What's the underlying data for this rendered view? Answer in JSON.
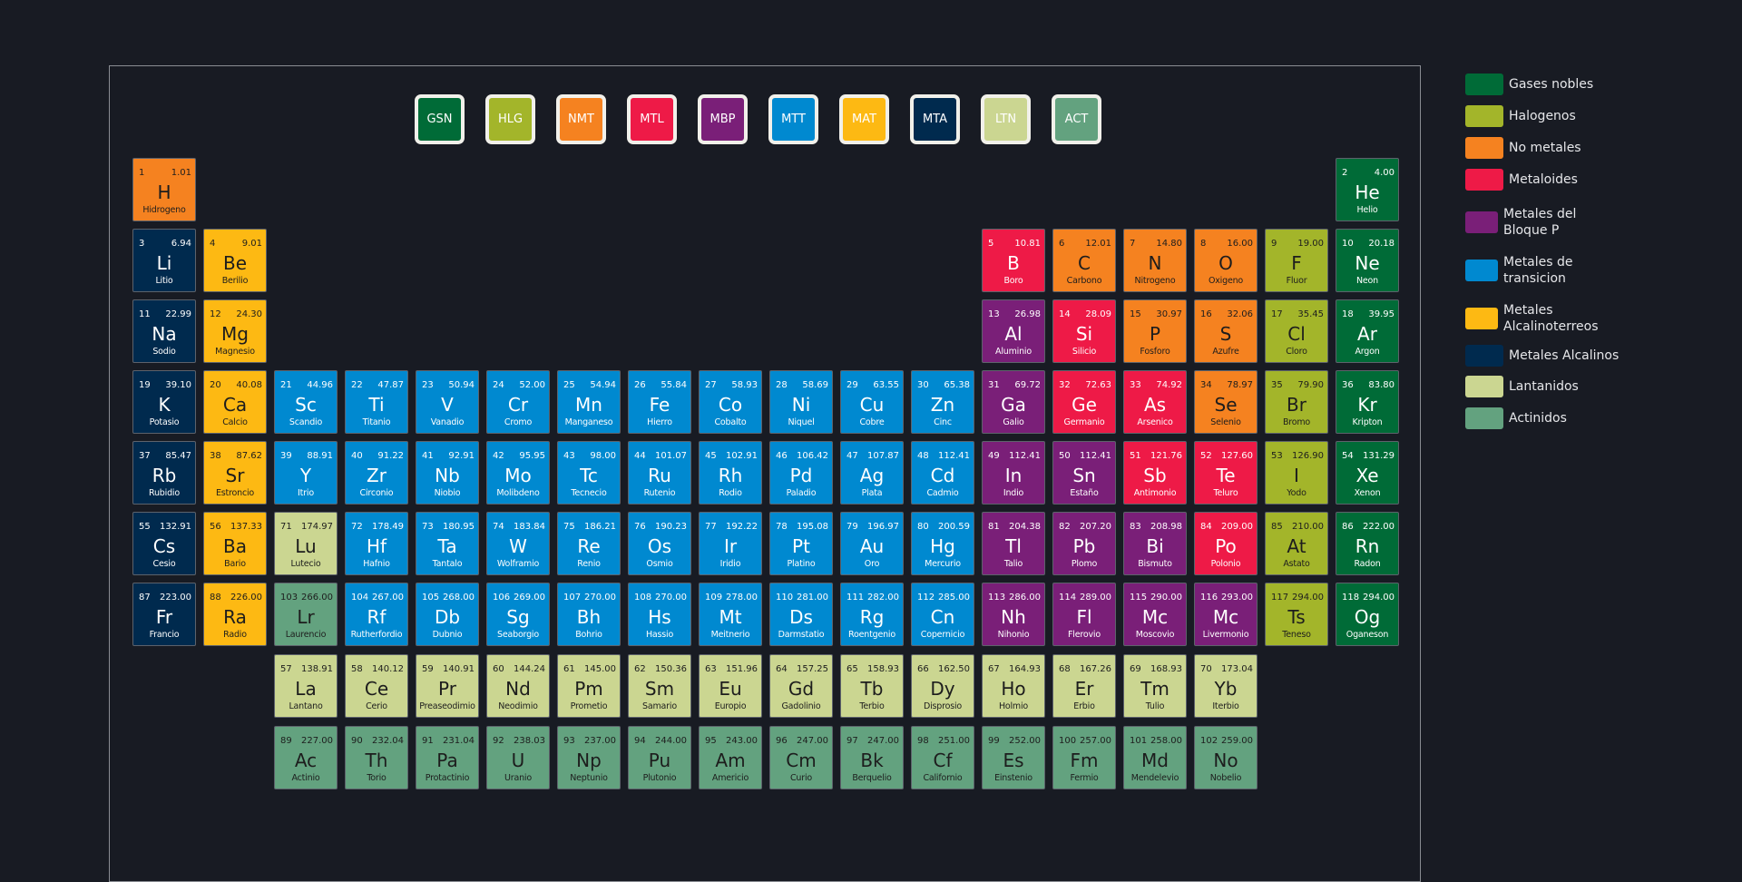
{
  "categories": [
    {
      "code": "GSN",
      "label": "Gases nobles",
      "color": "#006b37",
      "dark": false
    },
    {
      "code": "HLG",
      "label": "Halogenos",
      "color": "#a3b52a",
      "dark": true
    },
    {
      "code": "NMT",
      "label": "No metales",
      "color": "#f58220",
      "dark": true
    },
    {
      "code": "MTL",
      "label": "Metaloides",
      "color": "#ee1a47",
      "dark": false
    },
    {
      "code": "MBP",
      "label": "Metales del Bloque P",
      "color": "#7a1f78",
      "dark": false
    },
    {
      "code": "MTT",
      "label": "Metales de transicion",
      "color": "#0089d0",
      "dark": false
    },
    {
      "code": "MAT",
      "label": "Metales Alcalinoterreos",
      "color": "#fdb913",
      "dark": true
    },
    {
      "code": "MTA",
      "label": "Metales Alcalinos",
      "color": "#002a4e",
      "dark": false
    },
    {
      "code": "LTN",
      "label": "Lantanidos",
      "color": "#cbd691",
      "dark": true
    },
    {
      "code": "ACT",
      "label": "Actinidos",
      "color": "#63a27f",
      "dark": true
    }
  ],
  "elements": [
    {
      "n": "1",
      "m": "1.01",
      "s": "H",
      "name": "Hidrogeno",
      "c": "NMT",
      "period": 1,
      "group": 1
    },
    {
      "n": "2",
      "m": "4.00",
      "s": "He",
      "name": "Helio",
      "c": "GSN",
      "period": 1,
      "group": 18
    },
    {
      "n": "3",
      "m": "6.94",
      "s": "Li",
      "name": "Litio",
      "c": "MTA",
      "period": 2,
      "group": 1
    },
    {
      "n": "4",
      "m": "9.01",
      "s": "Be",
      "name": "Berilio",
      "c": "MAT",
      "period": 2,
      "group": 2
    },
    {
      "n": "5",
      "m": "10.81",
      "s": "B",
      "name": "Boro",
      "c": "MTL",
      "period": 2,
      "group": 13
    },
    {
      "n": "6",
      "m": "12.01",
      "s": "C",
      "name": "Carbono",
      "c": "NMT",
      "period": 2,
      "group": 14
    },
    {
      "n": "7",
      "m": "14.80",
      "s": "N",
      "name": "Nitrogeno",
      "c": "NMT",
      "period": 2,
      "group": 15
    },
    {
      "n": "8",
      "m": "16.00",
      "s": "O",
      "name": "Oxigeno",
      "c": "NMT",
      "period": 2,
      "group": 16
    },
    {
      "n": "9",
      "m": "19.00",
      "s": "F",
      "name": "Fluor",
      "c": "HLG",
      "period": 2,
      "group": 17
    },
    {
      "n": "10",
      "m": "20.18",
      "s": "Ne",
      "name": "Neon",
      "c": "GSN",
      "period": 2,
      "group": 18
    },
    {
      "n": "11",
      "m": "22.99",
      "s": "Na",
      "name": "Sodio",
      "c": "MTA",
      "period": 3,
      "group": 1
    },
    {
      "n": "12",
      "m": "24.30",
      "s": "Mg",
      "name": "Magnesio",
      "c": "MAT",
      "period": 3,
      "group": 2
    },
    {
      "n": "13",
      "m": "26.98",
      "s": "Al",
      "name": "Aluminio",
      "c": "MBP",
      "period": 3,
      "group": 13
    },
    {
      "n": "14",
      "m": "28.09",
      "s": "Si",
      "name": "Silicio",
      "c": "MTL",
      "period": 3,
      "group": 14
    },
    {
      "n": "15",
      "m": "30.97",
      "s": "P",
      "name": "Fosforo",
      "c": "NMT",
      "period": 3,
      "group": 15
    },
    {
      "n": "16",
      "m": "32.06",
      "s": "S",
      "name": "Azufre",
      "c": "NMT",
      "period": 3,
      "group": 16
    },
    {
      "n": "17",
      "m": "35.45",
      "s": "Cl",
      "name": "Cloro",
      "c": "HLG",
      "period": 3,
      "group": 17
    },
    {
      "n": "18",
      "m": "39.95",
      "s": "Ar",
      "name": "Argon",
      "c": "GSN",
      "period": 3,
      "group": 18
    },
    {
      "n": "19",
      "m": "39.10",
      "s": "K",
      "name": "Potasio",
      "c": "MTA",
      "period": 4,
      "group": 1
    },
    {
      "n": "20",
      "m": "40.08",
      "s": "Ca",
      "name": "Calcio",
      "c": "MAT",
      "period": 4,
      "group": 2
    },
    {
      "n": "21",
      "m": "44.96",
      "s": "Sc",
      "name": "Scandio",
      "c": "MTT",
      "period": 4,
      "group": 3
    },
    {
      "n": "22",
      "m": "47.87",
      "s": "Ti",
      "name": "Titanio",
      "c": "MTT",
      "period": 4,
      "group": 4
    },
    {
      "n": "23",
      "m": "50.94",
      "s": "V",
      "name": "Vanadio",
      "c": "MTT",
      "period": 4,
      "group": 5
    },
    {
      "n": "24",
      "m": "52.00",
      "s": "Cr",
      "name": "Cromo",
      "c": "MTT",
      "period": 4,
      "group": 6
    },
    {
      "n": "25",
      "m": "54.94",
      "s": "Mn",
      "name": "Manganeso",
      "c": "MTT",
      "period": 4,
      "group": 7
    },
    {
      "n": "26",
      "m": "55.84",
      "s": "Fe",
      "name": "Hierro",
      "c": "MTT",
      "period": 4,
      "group": 8
    },
    {
      "n": "27",
      "m": "58.93",
      "s": "Co",
      "name": "Cobalto",
      "c": "MTT",
      "period": 4,
      "group": 9
    },
    {
      "n": "28",
      "m": "58.69",
      "s": "Ni",
      "name": "Niquel",
      "c": "MTT",
      "period": 4,
      "group": 10
    },
    {
      "n": "29",
      "m": "63.55",
      "s": "Cu",
      "name": "Cobre",
      "c": "MTT",
      "period": 4,
      "group": 11
    },
    {
      "n": "30",
      "m": "65.38",
      "s": "Zn",
      "name": "Cinc",
      "c": "MTT",
      "period": 4,
      "group": 12
    },
    {
      "n": "31",
      "m": "69.72",
      "s": "Ga",
      "name": "Galio",
      "c": "MBP",
      "period": 4,
      "group": 13
    },
    {
      "n": "32",
      "m": "72.63",
      "s": "Ge",
      "name": "Germanio",
      "c": "MTL",
      "period": 4,
      "group": 14
    },
    {
      "n": "33",
      "m": "74.92",
      "s": "As",
      "name": "Arsenico",
      "c": "MTL",
      "period": 4,
      "group": 15
    },
    {
      "n": "34",
      "m": "78.97",
      "s": "Se",
      "name": "Selenio",
      "c": "NMT",
      "period": 4,
      "group": 16
    },
    {
      "n": "35",
      "m": "79.90",
      "s": "Br",
      "name": "Bromo",
      "c": "HLG",
      "period": 4,
      "group": 17
    },
    {
      "n": "36",
      "m": "83.80",
      "s": "Kr",
      "name": "Kripton",
      "c": "GSN",
      "period": 4,
      "group": 18
    },
    {
      "n": "37",
      "m": "85.47",
      "s": "Rb",
      "name": "Rubidio",
      "c": "MTA",
      "period": 5,
      "group": 1
    },
    {
      "n": "38",
      "m": "87.62",
      "s": "Sr",
      "name": "Estroncio",
      "c": "MAT",
      "period": 5,
      "group": 2
    },
    {
      "n": "39",
      "m": "88.91",
      "s": "Y",
      "name": "Itrio",
      "c": "MTT",
      "period": 5,
      "group": 3
    },
    {
      "n": "40",
      "m": "91.22",
      "s": "Zr",
      "name": "Circonio",
      "c": "MTT",
      "period": 5,
      "group": 4
    },
    {
      "n": "41",
      "m": "92.91",
      "s": "Nb",
      "name": "Niobio",
      "c": "MTT",
      "period": 5,
      "group": 5
    },
    {
      "n": "42",
      "m": "95.95",
      "s": "Mo",
      "name": "Molibdeno",
      "c": "MTT",
      "period": 5,
      "group": 6
    },
    {
      "n": "43",
      "m": "98.00",
      "s": "Tc",
      "name": "Tecnecio",
      "c": "MTT",
      "period": 5,
      "group": 7
    },
    {
      "n": "44",
      "m": "101.07",
      "s": "Ru",
      "name": "Rutenio",
      "c": "MTT",
      "period": 5,
      "group": 8
    },
    {
      "n": "45",
      "m": "102.91",
      "s": "Rh",
      "name": "Rodio",
      "c": "MTT",
      "period": 5,
      "group": 9
    },
    {
      "n": "46",
      "m": "106.42",
      "s": "Pd",
      "name": "Paladio",
      "c": "MTT",
      "period": 5,
      "group": 10
    },
    {
      "n": "47",
      "m": "107.87",
      "s": "Ag",
      "name": "Plata",
      "c": "MTT",
      "period": 5,
      "group": 11
    },
    {
      "n": "48",
      "m": "112.41",
      "s": "Cd",
      "name": "Cadmio",
      "c": "MTT",
      "period": 5,
      "group": 12
    },
    {
      "n": "49",
      "m": "112.41",
      "s": "In",
      "name": "Indio",
      "c": "MBP",
      "period": 5,
      "group": 13
    },
    {
      "n": "50",
      "m": "112.41",
      "s": "Sn",
      "name": "Estaño",
      "c": "MBP",
      "period": 5,
      "group": 14
    },
    {
      "n": "51",
      "m": "121.76",
      "s": "Sb",
      "name": "Antimonio",
      "c": "MTL",
      "period": 5,
      "group": 15
    },
    {
      "n": "52",
      "m": "127.60",
      "s": "Te",
      "name": "Teluro",
      "c": "MTL",
      "period": 5,
      "group": 16
    },
    {
      "n": "53",
      "m": "126.90",
      "s": "I",
      "name": "Yodo",
      "c": "HLG",
      "period": 5,
      "group": 17
    },
    {
      "n": "54",
      "m": "131.29",
      "s": "Xe",
      "name": "Xenon",
      "c": "GSN",
      "period": 5,
      "group": 18
    },
    {
      "n": "55",
      "m": "132.91",
      "s": "Cs",
      "name": "Cesio",
      "c": "MTA",
      "period": 6,
      "group": 1
    },
    {
      "n": "56",
      "m": "137.33",
      "s": "Ba",
      "name": "Bario",
      "c": "MAT",
      "period": 6,
      "group": 2
    },
    {
      "n": "71",
      "m": "174.97",
      "s": "Lu",
      "name": "Lutecio",
      "c": "LTN",
      "period": 6,
      "group": 3
    },
    {
      "n": "72",
      "m": "178.49",
      "s": "Hf",
      "name": "Hafnio",
      "c": "MTT",
      "period": 6,
      "group": 4
    },
    {
      "n": "73",
      "m": "180.95",
      "s": "Ta",
      "name": "Tantalo",
      "c": "MTT",
      "period": 6,
      "group": 5
    },
    {
      "n": "74",
      "m": "183.84",
      "s": "W",
      "name": "Wolframio",
      "c": "MTT",
      "period": 6,
      "group": 6
    },
    {
      "n": "75",
      "m": "186.21",
      "s": "Re",
      "name": "Renio",
      "c": "MTT",
      "period": 6,
      "group": 7
    },
    {
      "n": "76",
      "m": "190.23",
      "s": "Os",
      "name": "Osmio",
      "c": "MTT",
      "period": 6,
      "group": 8
    },
    {
      "n": "77",
      "m": "192.22",
      "s": "Ir",
      "name": "Iridio",
      "c": "MTT",
      "period": 6,
      "group": 9
    },
    {
      "n": "78",
      "m": "195.08",
      "s": "Pt",
      "name": "Platino",
      "c": "MTT",
      "period": 6,
      "group": 10
    },
    {
      "n": "79",
      "m": "196.97",
      "s": "Au",
      "name": "Oro",
      "c": "MTT",
      "period": 6,
      "group": 11
    },
    {
      "n": "80",
      "m": "200.59",
      "s": "Hg",
      "name": "Mercurio",
      "c": "MTT",
      "period": 6,
      "group": 12
    },
    {
      "n": "81",
      "m": "204.38",
      "s": "Tl",
      "name": "Talio",
      "c": "MBP",
      "period": 6,
      "group": 13
    },
    {
      "n": "82",
      "m": "207.20",
      "s": "Pb",
      "name": "Plomo",
      "c": "MBP",
      "period": 6,
      "group": 14
    },
    {
      "n": "83",
      "m": "208.98",
      "s": "Bi",
      "name": "Bismuto",
      "c": "MBP",
      "period": 6,
      "group": 15
    },
    {
      "n": "84",
      "m": "209.00",
      "s": "Po",
      "name": "Polonio",
      "c": "MTL",
      "period": 6,
      "group": 16
    },
    {
      "n": "85",
      "m": "210.00",
      "s": "At",
      "name": "Astato",
      "c": "HLG",
      "period": 6,
      "group": 17
    },
    {
      "n": "86",
      "m": "222.00",
      "s": "Rn",
      "name": "Radon",
      "c": "GSN",
      "period": 6,
      "group": 18
    },
    {
      "n": "87",
      "m": "223.00",
      "s": "Fr",
      "name": "Francio",
      "c": "MTA",
      "period": 7,
      "group": 1
    },
    {
      "n": "88",
      "m": "226.00",
      "s": "Ra",
      "name": "Radio",
      "c": "MAT",
      "period": 7,
      "group": 2
    },
    {
      "n": "103",
      "m": "266.00",
      "s": "Lr",
      "name": "Laurencio",
      "c": "ACT",
      "period": 7,
      "group": 3
    },
    {
      "n": "104",
      "m": "267.00",
      "s": "Rf",
      "name": "Rutherfordio",
      "c": "MTT",
      "period": 7,
      "group": 4
    },
    {
      "n": "105",
      "m": "268.00",
      "s": "Db",
      "name": "Dubnio",
      "c": "MTT",
      "period": 7,
      "group": 5
    },
    {
      "n": "106",
      "m": "269.00",
      "s": "Sg",
      "name": "Seaborgio",
      "c": "MTT",
      "period": 7,
      "group": 6
    },
    {
      "n": "107",
      "m": "270.00",
      "s": "Bh",
      "name": "Bohrio",
      "c": "MTT",
      "period": 7,
      "group": 7
    },
    {
      "n": "108",
      "m": "270.00",
      "s": "Hs",
      "name": "Hassio",
      "c": "MTT",
      "period": 7,
      "group": 8
    },
    {
      "n": "109",
      "m": "278.00",
      "s": "Mt",
      "name": "Meitnerio",
      "c": "MTT",
      "period": 7,
      "group": 9
    },
    {
      "n": "110",
      "m": "281.00",
      "s": "Ds",
      "name": "Darmstatio",
      "c": "MTT",
      "period": 7,
      "group": 10
    },
    {
      "n": "111",
      "m": "282.00",
      "s": "Rg",
      "name": "Roentgenio",
      "c": "MTT",
      "period": 7,
      "group": 11
    },
    {
      "n": "112",
      "m": "285.00",
      "s": "Cn",
      "name": "Copernicio",
      "c": "MTT",
      "period": 7,
      "group": 12
    },
    {
      "n": "113",
      "m": "286.00",
      "s": "Nh",
      "name": "Nihonio",
      "c": "MBP",
      "period": 7,
      "group": 13
    },
    {
      "n": "114",
      "m": "289.00",
      "s": "Fl",
      "name": "Flerovio",
      "c": "MBP",
      "period": 7,
      "group": 14
    },
    {
      "n": "115",
      "m": "290.00",
      "s": "Mc",
      "name": "Moscovio",
      "c": "MBP",
      "period": 7,
      "group": 15
    },
    {
      "n": "116",
      "m": "293.00",
      "s": "Mc",
      "name": "Livermonio",
      "c": "MBP",
      "period": 7,
      "group": 16
    },
    {
      "n": "117",
      "m": "294.00",
      "s": "Ts",
      "name": "Teneso",
      "c": "HLG",
      "period": 7,
      "group": 17
    },
    {
      "n": "118",
      "m": "294.00",
      "s": "Og",
      "name": "Oganeson",
      "c": "GSN",
      "period": 7,
      "group": 18
    },
    {
      "n": "57",
      "m": "138.91",
      "s": "La",
      "name": "Lantano",
      "c": "LTN",
      "period": 8,
      "group": 3
    },
    {
      "n": "58",
      "m": "140.12",
      "s": "Ce",
      "name": "Cerio",
      "c": "LTN",
      "period": 8,
      "group": 4
    },
    {
      "n": "59",
      "m": "140.91",
      "s": "Pr",
      "name": "Preaseodimio",
      "c": "LTN",
      "period": 8,
      "group": 5
    },
    {
      "n": "60",
      "m": "144.24",
      "s": "Nd",
      "name": "Neodimio",
      "c": "LTN",
      "period": 8,
      "group": 6
    },
    {
      "n": "61",
      "m": "145.00",
      "s": "Pm",
      "name": "Prometio",
      "c": "LTN",
      "period": 8,
      "group": 7
    },
    {
      "n": "62",
      "m": "150.36",
      "s": "Sm",
      "name": "Samario",
      "c": "LTN",
      "period": 8,
      "group": 8
    },
    {
      "n": "63",
      "m": "151.96",
      "s": "Eu",
      "name": "Europio",
      "c": "LTN",
      "period": 8,
      "group": 9
    },
    {
      "n": "64",
      "m": "157.25",
      "s": "Gd",
      "name": "Gadolinio",
      "c": "LTN",
      "period": 8,
      "group": 10
    },
    {
      "n": "65",
      "m": "158.93",
      "s": "Tb",
      "name": "Terbio",
      "c": "LTN",
      "period": 8,
      "group": 11
    },
    {
      "n": "66",
      "m": "162.50",
      "s": "Dy",
      "name": "Disprosio",
      "c": "LTN",
      "period": 8,
      "group": 12
    },
    {
      "n": "67",
      "m": "164.93",
      "s": "Ho",
      "name": "Holmio",
      "c": "LTN",
      "period": 8,
      "group": 13
    },
    {
      "n": "68",
      "m": "167.26",
      "s": "Er",
      "name": "Erbio",
      "c": "LTN",
      "period": 8,
      "group": 14
    },
    {
      "n": "69",
      "m": "168.93",
      "s": "Tm",
      "name": "Tulio",
      "c": "LTN",
      "period": 8,
      "group": 15
    },
    {
      "n": "70",
      "m": "173.04",
      "s": "Yb",
      "name": "Iterbio",
      "c": "LTN",
      "period": 8,
      "group": 16
    },
    {
      "n": "89",
      "m": "227.00",
      "s": "Ac",
      "name": "Actinio",
      "c": "ACT",
      "period": 9,
      "group": 3
    },
    {
      "n": "90",
      "m": "232.04",
      "s": "Th",
      "name": "Torio",
      "c": "ACT",
      "period": 9,
      "group": 4
    },
    {
      "n": "91",
      "m": "231.04",
      "s": "Pa",
      "name": "Protactinio",
      "c": "ACT",
      "period": 9,
      "group": 5
    },
    {
      "n": "92",
      "m": "238.03",
      "s": "U",
      "name": "Uranio",
      "c": "ACT",
      "period": 9,
      "group": 6
    },
    {
      "n": "93",
      "m": "237.00",
      "s": "Np",
      "name": "Neptunio",
      "c": "ACT",
      "period": 9,
      "group": 7
    },
    {
      "n": "94",
      "m": "244.00",
      "s": "Pu",
      "name": "Plutonio",
      "c": "ACT",
      "period": 9,
      "group": 8
    },
    {
      "n": "95",
      "m": "243.00",
      "s": "Am",
      "name": "Americio",
      "c": "ACT",
      "period": 9,
      "group": 9
    },
    {
      "n": "96",
      "m": "247.00",
      "s": "Cm",
      "name": "Curio",
      "c": "ACT",
      "period": 9,
      "group": 10
    },
    {
      "n": "97",
      "m": "247.00",
      "s": "Bk",
      "name": "Berquelio",
      "c": "ACT",
      "period": 9,
      "group": 11
    },
    {
      "n": "98",
      "m": "251.00",
      "s": "Cf",
      "name": "Californio",
      "c": "ACT",
      "period": 9,
      "group": 12
    },
    {
      "n": "99",
      "m": "252.00",
      "s": "Es",
      "name": "Einstenio",
      "c": "ACT",
      "period": 9,
      "group": 13
    },
    {
      "n": "100",
      "m": "257.00",
      "s": "Fm",
      "name": "Fermio",
      "c": "ACT",
      "period": 9,
      "group": 14
    },
    {
      "n": "101",
      "m": "258.00",
      "s": "Md",
      "name": "Mendelevio",
      "c": "ACT",
      "period": 9,
      "group": 15
    },
    {
      "n": "102",
      "m": "259.00",
      "s": "No",
      "name": "Nobelio",
      "c": "ACT",
      "period": 9,
      "group": 16
    }
  ]
}
